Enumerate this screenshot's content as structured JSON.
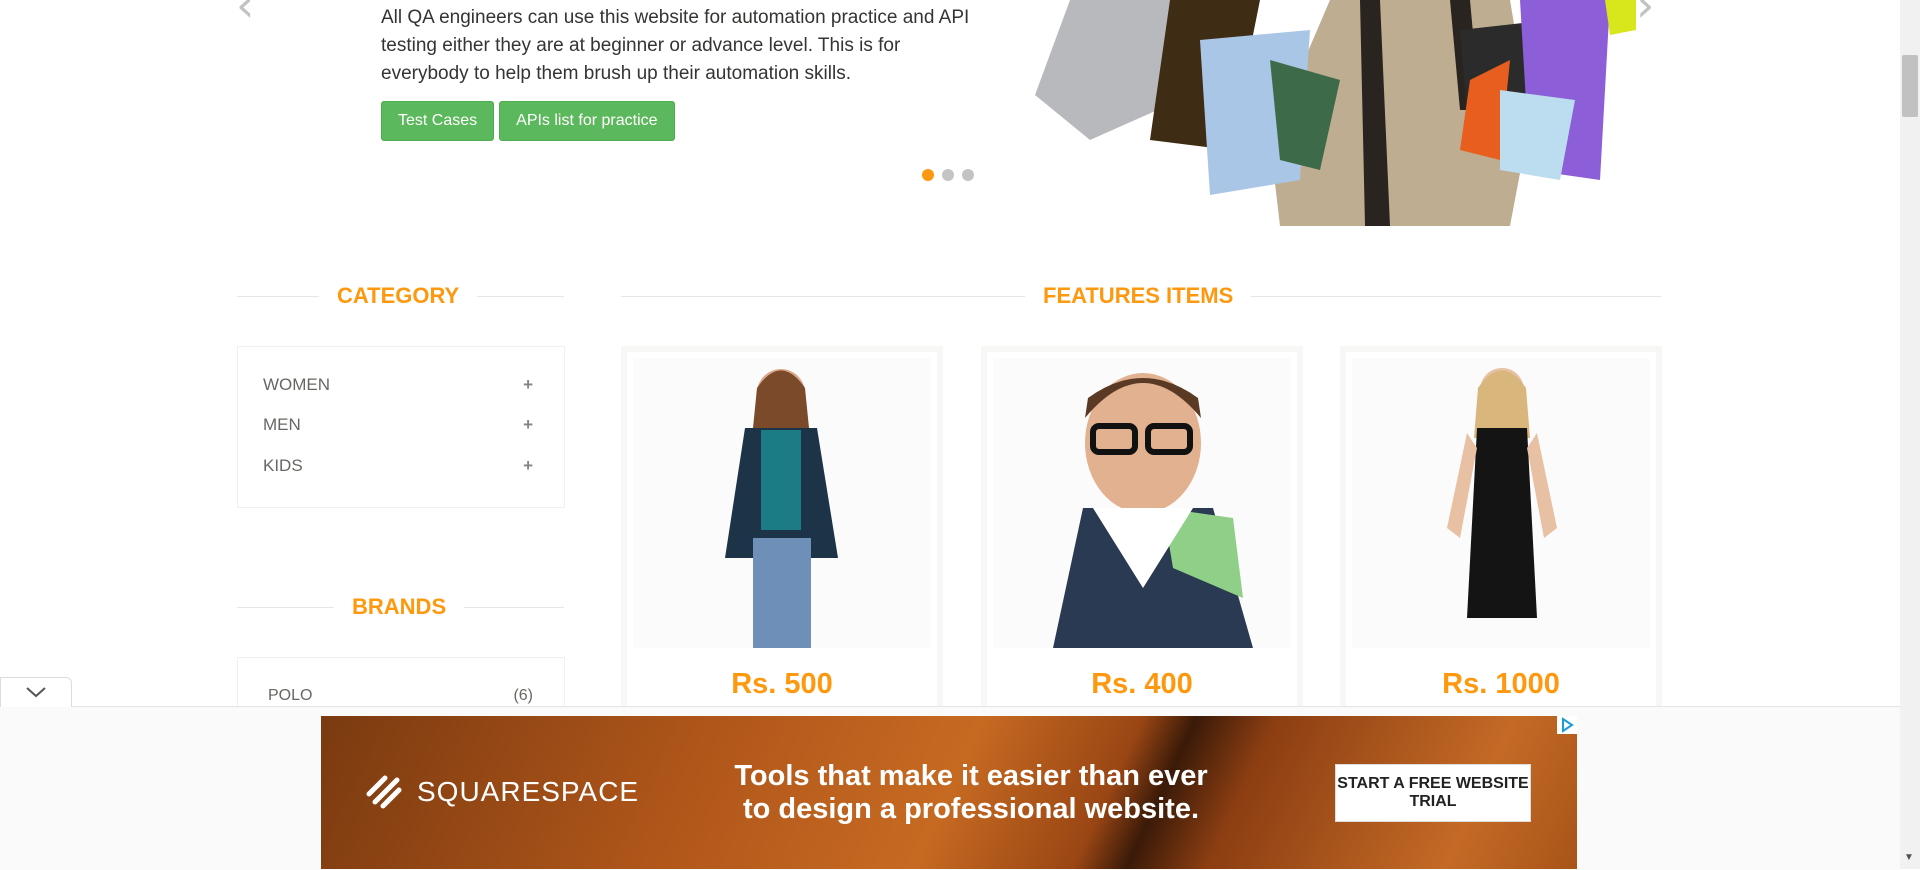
{
  "hero": {
    "text": "All QA engineers can use this website for automation practice and API testing either they are at beginner or advance level. This is for everybody to help them brush up their automation skills.",
    "buttons": [
      "Test Cases",
      "APIs list for practice"
    ],
    "slide_count": 3,
    "active_slide": 1
  },
  "category": {
    "title": "CATEGORY",
    "items": [
      {
        "label": "WOMEN",
        "toggle": "+"
      },
      {
        "label": "MEN",
        "toggle": "+"
      },
      {
        "label": "KIDS",
        "toggle": "+"
      }
    ]
  },
  "brands": {
    "title": "BRANDS",
    "items": [
      {
        "label": "POLO",
        "count": "(6)"
      }
    ]
  },
  "features": {
    "title": "FEATURES ITEMS",
    "products": [
      {
        "price": "Rs. 500"
      },
      {
        "price": "Rs. 400"
      },
      {
        "price": "Rs. 1000"
      }
    ]
  },
  "ad": {
    "brand": "SQUARESPACE",
    "headline_line1": "Tools that make it easier than ever",
    "headline_line2": "to design a professional website.",
    "cta": "START A FREE WEBSITE TRIAL"
  },
  "colors": {
    "accent": "#fe980f",
    "button_green": "#5cb85c"
  }
}
